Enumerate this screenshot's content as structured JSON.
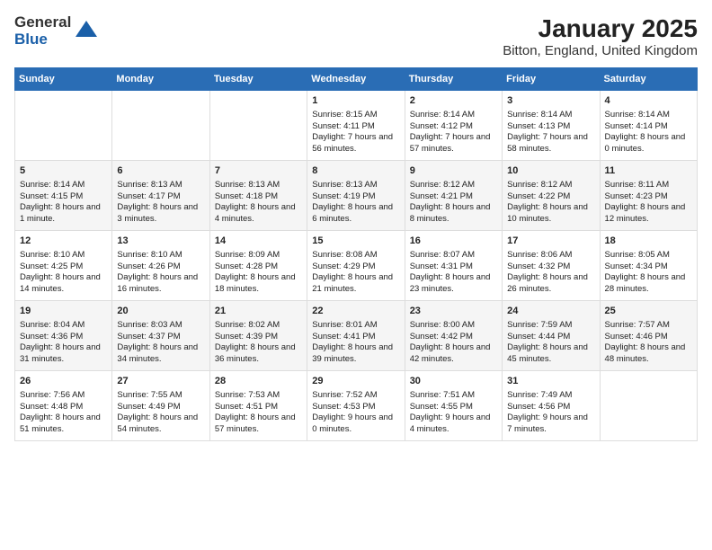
{
  "logo": {
    "general": "General",
    "blue": "Blue"
  },
  "title": "January 2025",
  "subtitle": "Bitton, England, United Kingdom",
  "days": [
    "Sunday",
    "Monday",
    "Tuesday",
    "Wednesday",
    "Thursday",
    "Friday",
    "Saturday"
  ],
  "weeks": [
    [
      {
        "num": "",
        "text": ""
      },
      {
        "num": "",
        "text": ""
      },
      {
        "num": "",
        "text": ""
      },
      {
        "num": "1",
        "text": "Sunrise: 8:15 AM\nSunset: 4:11 PM\nDaylight: 7 hours and 56 minutes."
      },
      {
        "num": "2",
        "text": "Sunrise: 8:14 AM\nSunset: 4:12 PM\nDaylight: 7 hours and 57 minutes."
      },
      {
        "num": "3",
        "text": "Sunrise: 8:14 AM\nSunset: 4:13 PM\nDaylight: 7 hours and 58 minutes."
      },
      {
        "num": "4",
        "text": "Sunrise: 8:14 AM\nSunset: 4:14 PM\nDaylight: 8 hours and 0 minutes."
      }
    ],
    [
      {
        "num": "5",
        "text": "Sunrise: 8:14 AM\nSunset: 4:15 PM\nDaylight: 8 hours and 1 minute."
      },
      {
        "num": "6",
        "text": "Sunrise: 8:13 AM\nSunset: 4:17 PM\nDaylight: 8 hours and 3 minutes."
      },
      {
        "num": "7",
        "text": "Sunrise: 8:13 AM\nSunset: 4:18 PM\nDaylight: 8 hours and 4 minutes."
      },
      {
        "num": "8",
        "text": "Sunrise: 8:13 AM\nSunset: 4:19 PM\nDaylight: 8 hours and 6 minutes."
      },
      {
        "num": "9",
        "text": "Sunrise: 8:12 AM\nSunset: 4:21 PM\nDaylight: 8 hours and 8 minutes."
      },
      {
        "num": "10",
        "text": "Sunrise: 8:12 AM\nSunset: 4:22 PM\nDaylight: 8 hours and 10 minutes."
      },
      {
        "num": "11",
        "text": "Sunrise: 8:11 AM\nSunset: 4:23 PM\nDaylight: 8 hours and 12 minutes."
      }
    ],
    [
      {
        "num": "12",
        "text": "Sunrise: 8:10 AM\nSunset: 4:25 PM\nDaylight: 8 hours and 14 minutes."
      },
      {
        "num": "13",
        "text": "Sunrise: 8:10 AM\nSunset: 4:26 PM\nDaylight: 8 hours and 16 minutes."
      },
      {
        "num": "14",
        "text": "Sunrise: 8:09 AM\nSunset: 4:28 PM\nDaylight: 8 hours and 18 minutes."
      },
      {
        "num": "15",
        "text": "Sunrise: 8:08 AM\nSunset: 4:29 PM\nDaylight: 8 hours and 21 minutes."
      },
      {
        "num": "16",
        "text": "Sunrise: 8:07 AM\nSunset: 4:31 PM\nDaylight: 8 hours and 23 minutes."
      },
      {
        "num": "17",
        "text": "Sunrise: 8:06 AM\nSunset: 4:32 PM\nDaylight: 8 hours and 26 minutes."
      },
      {
        "num": "18",
        "text": "Sunrise: 8:05 AM\nSunset: 4:34 PM\nDaylight: 8 hours and 28 minutes."
      }
    ],
    [
      {
        "num": "19",
        "text": "Sunrise: 8:04 AM\nSunset: 4:36 PM\nDaylight: 8 hours and 31 minutes."
      },
      {
        "num": "20",
        "text": "Sunrise: 8:03 AM\nSunset: 4:37 PM\nDaylight: 8 hours and 34 minutes."
      },
      {
        "num": "21",
        "text": "Sunrise: 8:02 AM\nSunset: 4:39 PM\nDaylight: 8 hours and 36 minutes."
      },
      {
        "num": "22",
        "text": "Sunrise: 8:01 AM\nSunset: 4:41 PM\nDaylight: 8 hours and 39 minutes."
      },
      {
        "num": "23",
        "text": "Sunrise: 8:00 AM\nSunset: 4:42 PM\nDaylight: 8 hours and 42 minutes."
      },
      {
        "num": "24",
        "text": "Sunrise: 7:59 AM\nSunset: 4:44 PM\nDaylight: 8 hours and 45 minutes."
      },
      {
        "num": "25",
        "text": "Sunrise: 7:57 AM\nSunset: 4:46 PM\nDaylight: 8 hours and 48 minutes."
      }
    ],
    [
      {
        "num": "26",
        "text": "Sunrise: 7:56 AM\nSunset: 4:48 PM\nDaylight: 8 hours and 51 minutes."
      },
      {
        "num": "27",
        "text": "Sunrise: 7:55 AM\nSunset: 4:49 PM\nDaylight: 8 hours and 54 minutes."
      },
      {
        "num": "28",
        "text": "Sunrise: 7:53 AM\nSunset: 4:51 PM\nDaylight: 8 hours and 57 minutes."
      },
      {
        "num": "29",
        "text": "Sunrise: 7:52 AM\nSunset: 4:53 PM\nDaylight: 9 hours and 0 minutes."
      },
      {
        "num": "30",
        "text": "Sunrise: 7:51 AM\nSunset: 4:55 PM\nDaylight: 9 hours and 4 minutes."
      },
      {
        "num": "31",
        "text": "Sunrise: 7:49 AM\nSunset: 4:56 PM\nDaylight: 9 hours and 7 minutes."
      },
      {
        "num": "",
        "text": ""
      }
    ]
  ]
}
